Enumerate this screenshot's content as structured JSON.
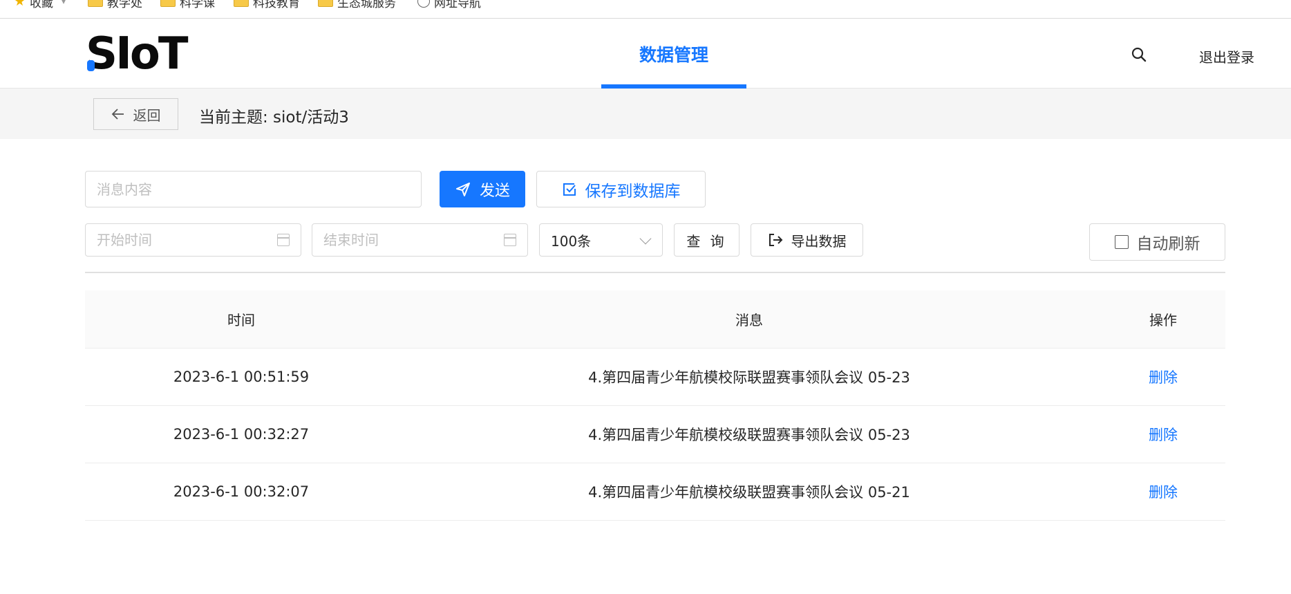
{
  "bookmarks": [
    {
      "label": "收藏",
      "icon": "star-icon"
    },
    {
      "label": "教学处",
      "icon": "folder-icon"
    },
    {
      "label": "科学课",
      "icon": "folder-icon"
    },
    {
      "label": "科技教育",
      "icon": "folder-icon"
    },
    {
      "label": "生态城服务",
      "icon": "folder-icon"
    },
    {
      "label": "网址导航",
      "icon": "globe-icon"
    }
  ],
  "header": {
    "logo": "SIoT",
    "nav_active": "数据管理",
    "logout": "退出登录"
  },
  "topic_bar": {
    "back_label": "返回",
    "title": "当前主题: siot/活动3"
  },
  "controls": {
    "message_placeholder": "消息内容",
    "send_label": "发送",
    "save_db_label": "保存到数据库",
    "start_placeholder": "开始时间",
    "end_placeholder": "结束时间",
    "limit_value": "100条",
    "query_label": "查 询",
    "export_label": "导出数据",
    "auto_refresh_label": "自动刷新"
  },
  "table": {
    "headers": {
      "time": "时间",
      "message": "消息",
      "action": "操作"
    },
    "rows": [
      {
        "time": "2023-6-1 00:51:59",
        "message": "4.第四届青少年航模校际联盟赛事领队会议 05-23",
        "action": "删除"
      },
      {
        "time": "2023-6-1 00:32:27",
        "message": "4.第四届青少年航模校级联盟赛事领队会议 05-23",
        "action": "删除"
      },
      {
        "time": "2023-6-1 00:32:07",
        "message": "4.第四届青少年航模校级联盟赛事领队会议 05-21",
        "action": "删除"
      }
    ]
  },
  "colors": {
    "accent": "#1677ff",
    "topic_bar_bg": "#f5f5f5"
  }
}
